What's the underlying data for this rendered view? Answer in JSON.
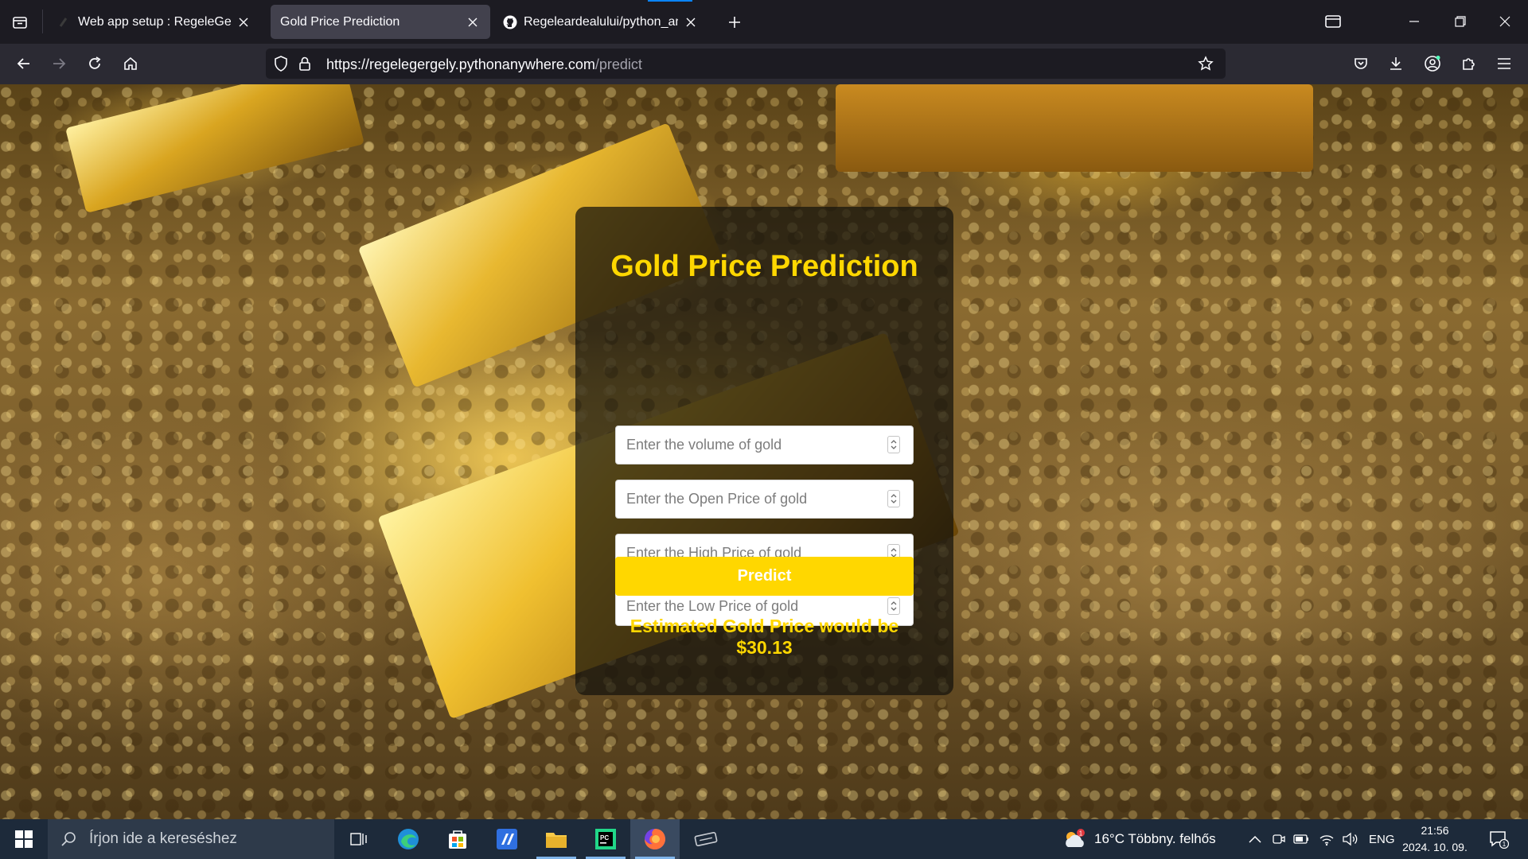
{
  "browser": {
    "tabs": [
      {
        "title": "Web app setup : RegeleGergely",
        "active": false,
        "icon": "pythonanywhere-favicon"
      },
      {
        "title": "Gold Price Prediction",
        "active": true,
        "icon": "none"
      },
      {
        "title": "Regeleardealului/python_anywh",
        "active": false,
        "icon": "github-icon"
      }
    ],
    "url_host": "https://regelegergely.pythonanywhere.com",
    "url_path": "/predict"
  },
  "page": {
    "title": "Gold Price Prediction",
    "fields": [
      {
        "placeholder": "Enter the volume of gold"
      },
      {
        "placeholder": "Enter the Open Price of gold"
      },
      {
        "placeholder": "Enter the High Price of gold"
      },
      {
        "placeholder": "Enter the Low Price of gold"
      }
    ],
    "predict_label": "Predict",
    "result_line1": "Estimated Gold Price would be",
    "result_line2": "$30.13",
    "colors": {
      "accent": "#ffd700",
      "card": "rgba(20,18,12,0.72)"
    }
  },
  "taskbar": {
    "search_placeholder": "Írjon ide a kereséshez",
    "weather": "16°C  Többny. felhős",
    "weather_badge": "1",
    "language": "ENG",
    "time": "21:56",
    "date": "2024. 10. 09.",
    "notification_count": "1"
  }
}
